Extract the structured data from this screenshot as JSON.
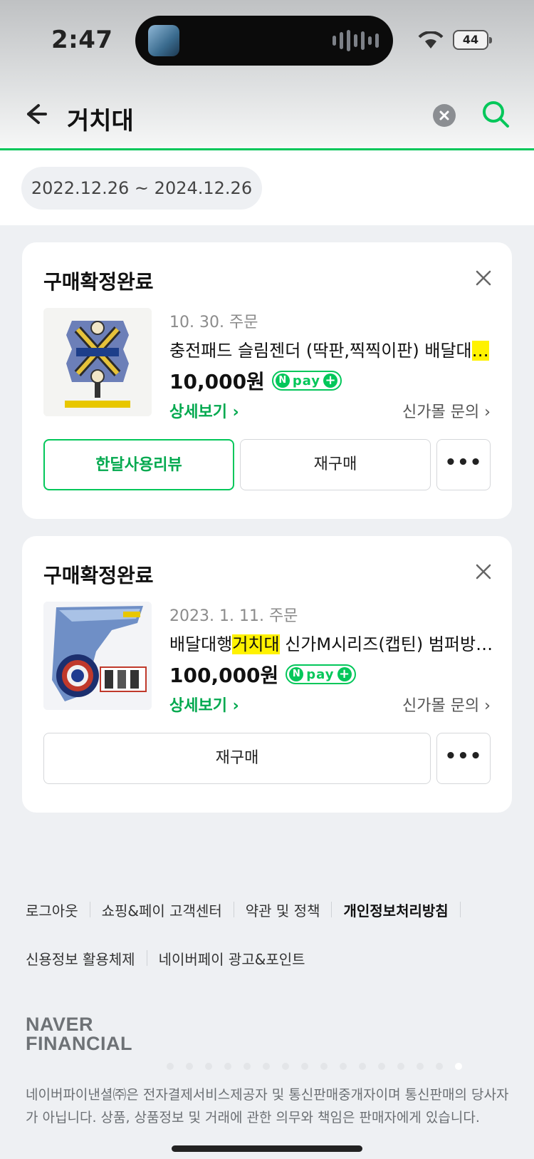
{
  "status_bar": {
    "time": "2:47",
    "battery": "44"
  },
  "search": {
    "query": "거치대"
  },
  "date_filter": {
    "range": "2022.12.26 ~ 2024.12.26"
  },
  "orders": [
    {
      "status": "구매확정완료",
      "order_date": "10. 30. 주문",
      "title": "충전패드 슬림젠더 (딱판,찍찍이판) 배달대",
      "title_tail": "…",
      "price": "10,000원",
      "detail_label": "상세보기 ›",
      "inquiry_label": "신가몰 문의 ›",
      "buttons": {
        "review": "한달사용리뷰",
        "rebuy": "재구매",
        "more": "•••"
      }
    },
    {
      "status": "구매확정완료",
      "order_date": "2023. 1. 11. 주문",
      "title_pre": "배달대행",
      "title_hl": "거치대",
      "title_post": " 신가M시리즈(캡틴) 범퍼방…",
      "price": "100,000원",
      "detail_label": "상세보기 ›",
      "inquiry_label": "신가몰 문의 ›",
      "buttons": {
        "rebuy": "재구매",
        "more": "•••"
      }
    }
  ],
  "npay": {
    "n": "N",
    "label": "pay",
    "plus": "+"
  },
  "footer": {
    "links_row1": [
      "로그아웃",
      "쇼핑&페이 고객센터",
      "약관 및 정책",
      "개인정보처리방침"
    ],
    "links_row2": [
      "신용정보 활용체제",
      "네이버페이 광고&포인트"
    ],
    "logo_line1": "NAVER",
    "logo_line2": "FINANCIAL",
    "legal": "네이버파이낸셜㈜은 전자결제서비스제공자 및 통신판매중개자이며 통신판매의 당사자가 아닙니다. 상품, 상품정보 및 거래에 관한 의무와 책임은 판매자에게 있습니다."
  },
  "colors": {
    "accent": "#03c75a",
    "highlight": "#fff200"
  }
}
